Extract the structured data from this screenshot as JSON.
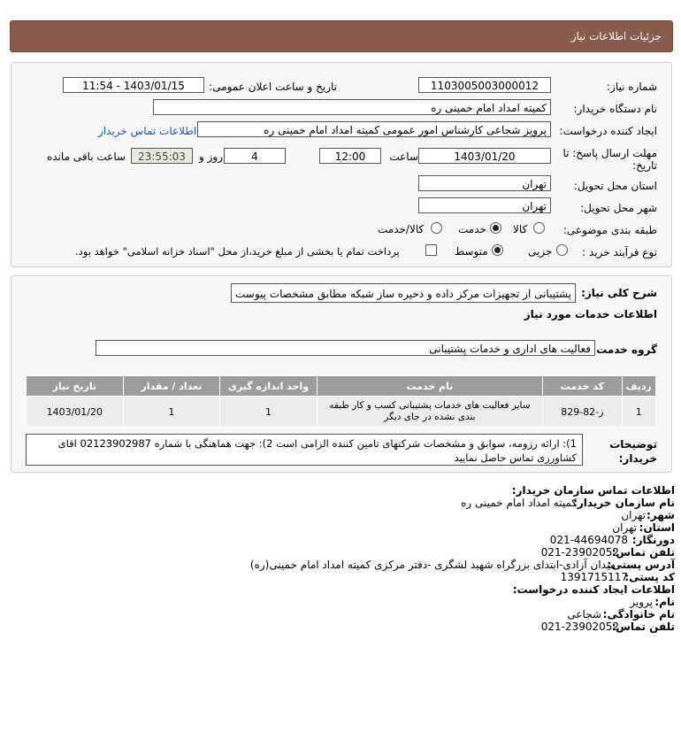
{
  "header": {
    "title": "جزئیات اطلاعات نیاز"
  },
  "form": {
    "need_number_label": "شماره نیاز:",
    "need_number": "1103005003000012",
    "announce_label": "تاریخ و ساعت اعلان عمومی:",
    "announce_value": "1403/01/15 - 11:54",
    "buyer_label": "نام دستگاه خریدار:",
    "buyer_value": "کمیته امداد امام خمینی ره",
    "creator_label": "ایجاد کننده درخواست:",
    "creator_value": "پرویز شجاعی کارشناس امور عمومی کمیته امداد امام خمینی ره",
    "contact_link": "اطلاعات تماس خریدار",
    "deadline_label": "مهلت ارسال پاسخ: تا",
    "deadline_label2": "تاریخ:",
    "deadline_date": "1403/01/20",
    "time_label": "ساعت",
    "deadline_time": "12:00",
    "days_value": "4",
    "days_label": "روز و",
    "remaining_time": "23:55:03",
    "remaining_label": "ساعت باقی مانده",
    "province_label": "استان محل تحویل:",
    "province_value": "تهران",
    "city_label": "شهر محل تحویل:",
    "city_value": "تهران",
    "category_label": "طبقه بندی موضوعی:",
    "category_options": [
      "کالا",
      "خدمت",
      "کالا/خدمت"
    ],
    "category_selected": "خدمت",
    "process_label": "نوع فرآیند خرید :",
    "process_options": [
      "جزیی",
      "متوسط"
    ],
    "process_selected": "متوسط",
    "payment_note": "پرداخت تمام یا بخشی از مبلغ خرید،از محل \"اسناد خزانه اسلامی\" خواهد بود."
  },
  "description": {
    "label": "شرح کلی نیاز:",
    "value": "پشتیبانی از تجهیزات مرکز داده و ذخیره ساز شبکه مطابق مشخصات پیوست",
    "services_title": "اطلاعات خدمات مورد نیاز",
    "group_label": "گروه خدمت:",
    "group_value": "فعالیت های اداری و خدمات پشتیبانی"
  },
  "table": {
    "headers": [
      "ردیف",
      "کد خدمت",
      "نام خدمت",
      "واحد اندازه گیری",
      "تعداد / مقدار",
      "تاریخ نیاز"
    ],
    "rows": [
      [
        "1",
        "ز-82-829",
        "سایر فعالیت های خدمات پشتیبانی کسب و کار طبقه بندی نشده در جای دیگر",
        "1",
        "1",
        "1403/01/20"
      ]
    ]
  },
  "notes": {
    "label": "توضیحات خریدار:",
    "value": "1): ارائه رزومه، سوابق و مشخصات شرکتهای تامین کننده الزامی است 2): جهت هماهنگی با شماره 02123902987 اقای کشاورزی تماس حاصل نمایید"
  },
  "contact": {
    "title": "اطلاعات تماس سازمان خریدار:",
    "org_label": "نام سازمان خریدار:",
    "org_value": "کمیته امداد امام خمینی ره",
    "city_label": "شهر:",
    "city_value": "تهران",
    "province_label": "استان:",
    "province_value": "تهران",
    "fax_label": "دورنگار:",
    "fax_value": "021-44694078",
    "phone_label": "تلفن تماس:",
    "phone_value": "021-23902052",
    "address_label": "آدرس پستی:",
    "address_value": "میدان آزادی-ابتدای بزرگراه شهید لشگری -دفتر مرکزی کمیته امداد امام خمینی(ره)",
    "postal_label": "کد پستی:",
    "postal_value": "1391715117",
    "creator_title": "اطلاعات ایجاد کننده درخواست:",
    "name_label": "نام:",
    "name_value": "پرویز",
    "family_label": "نام خانوادگی:",
    "family_value": "شجاعی",
    "creator_phone_label": "تلفن تماس:",
    "creator_phone_value": "021-23902052"
  }
}
